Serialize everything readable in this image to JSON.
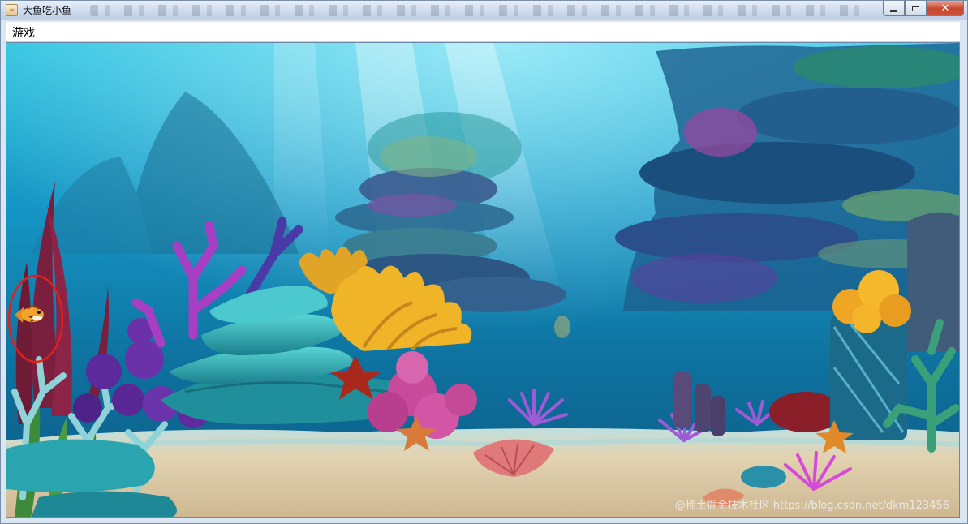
{
  "window": {
    "title": "大鱼吃小鱼",
    "icon": "java-cup-icon",
    "controls": {
      "minimize": "minimize-icon",
      "maximize": "maximize-icon",
      "close": "✕"
    }
  },
  "menubar": {
    "items": [
      {
        "label": "游戏"
      }
    ]
  },
  "game": {
    "scene": "underwater-coral-reef",
    "player_highlight_color": "#e0201a",
    "colors": {
      "water_top": "#1fb4d6",
      "water_deep": "#0a5f8a",
      "sand": "#d9c9a6"
    }
  },
  "watermark": "@稀土掘金技术社区 https://blog.csdn.net/dkm123456"
}
